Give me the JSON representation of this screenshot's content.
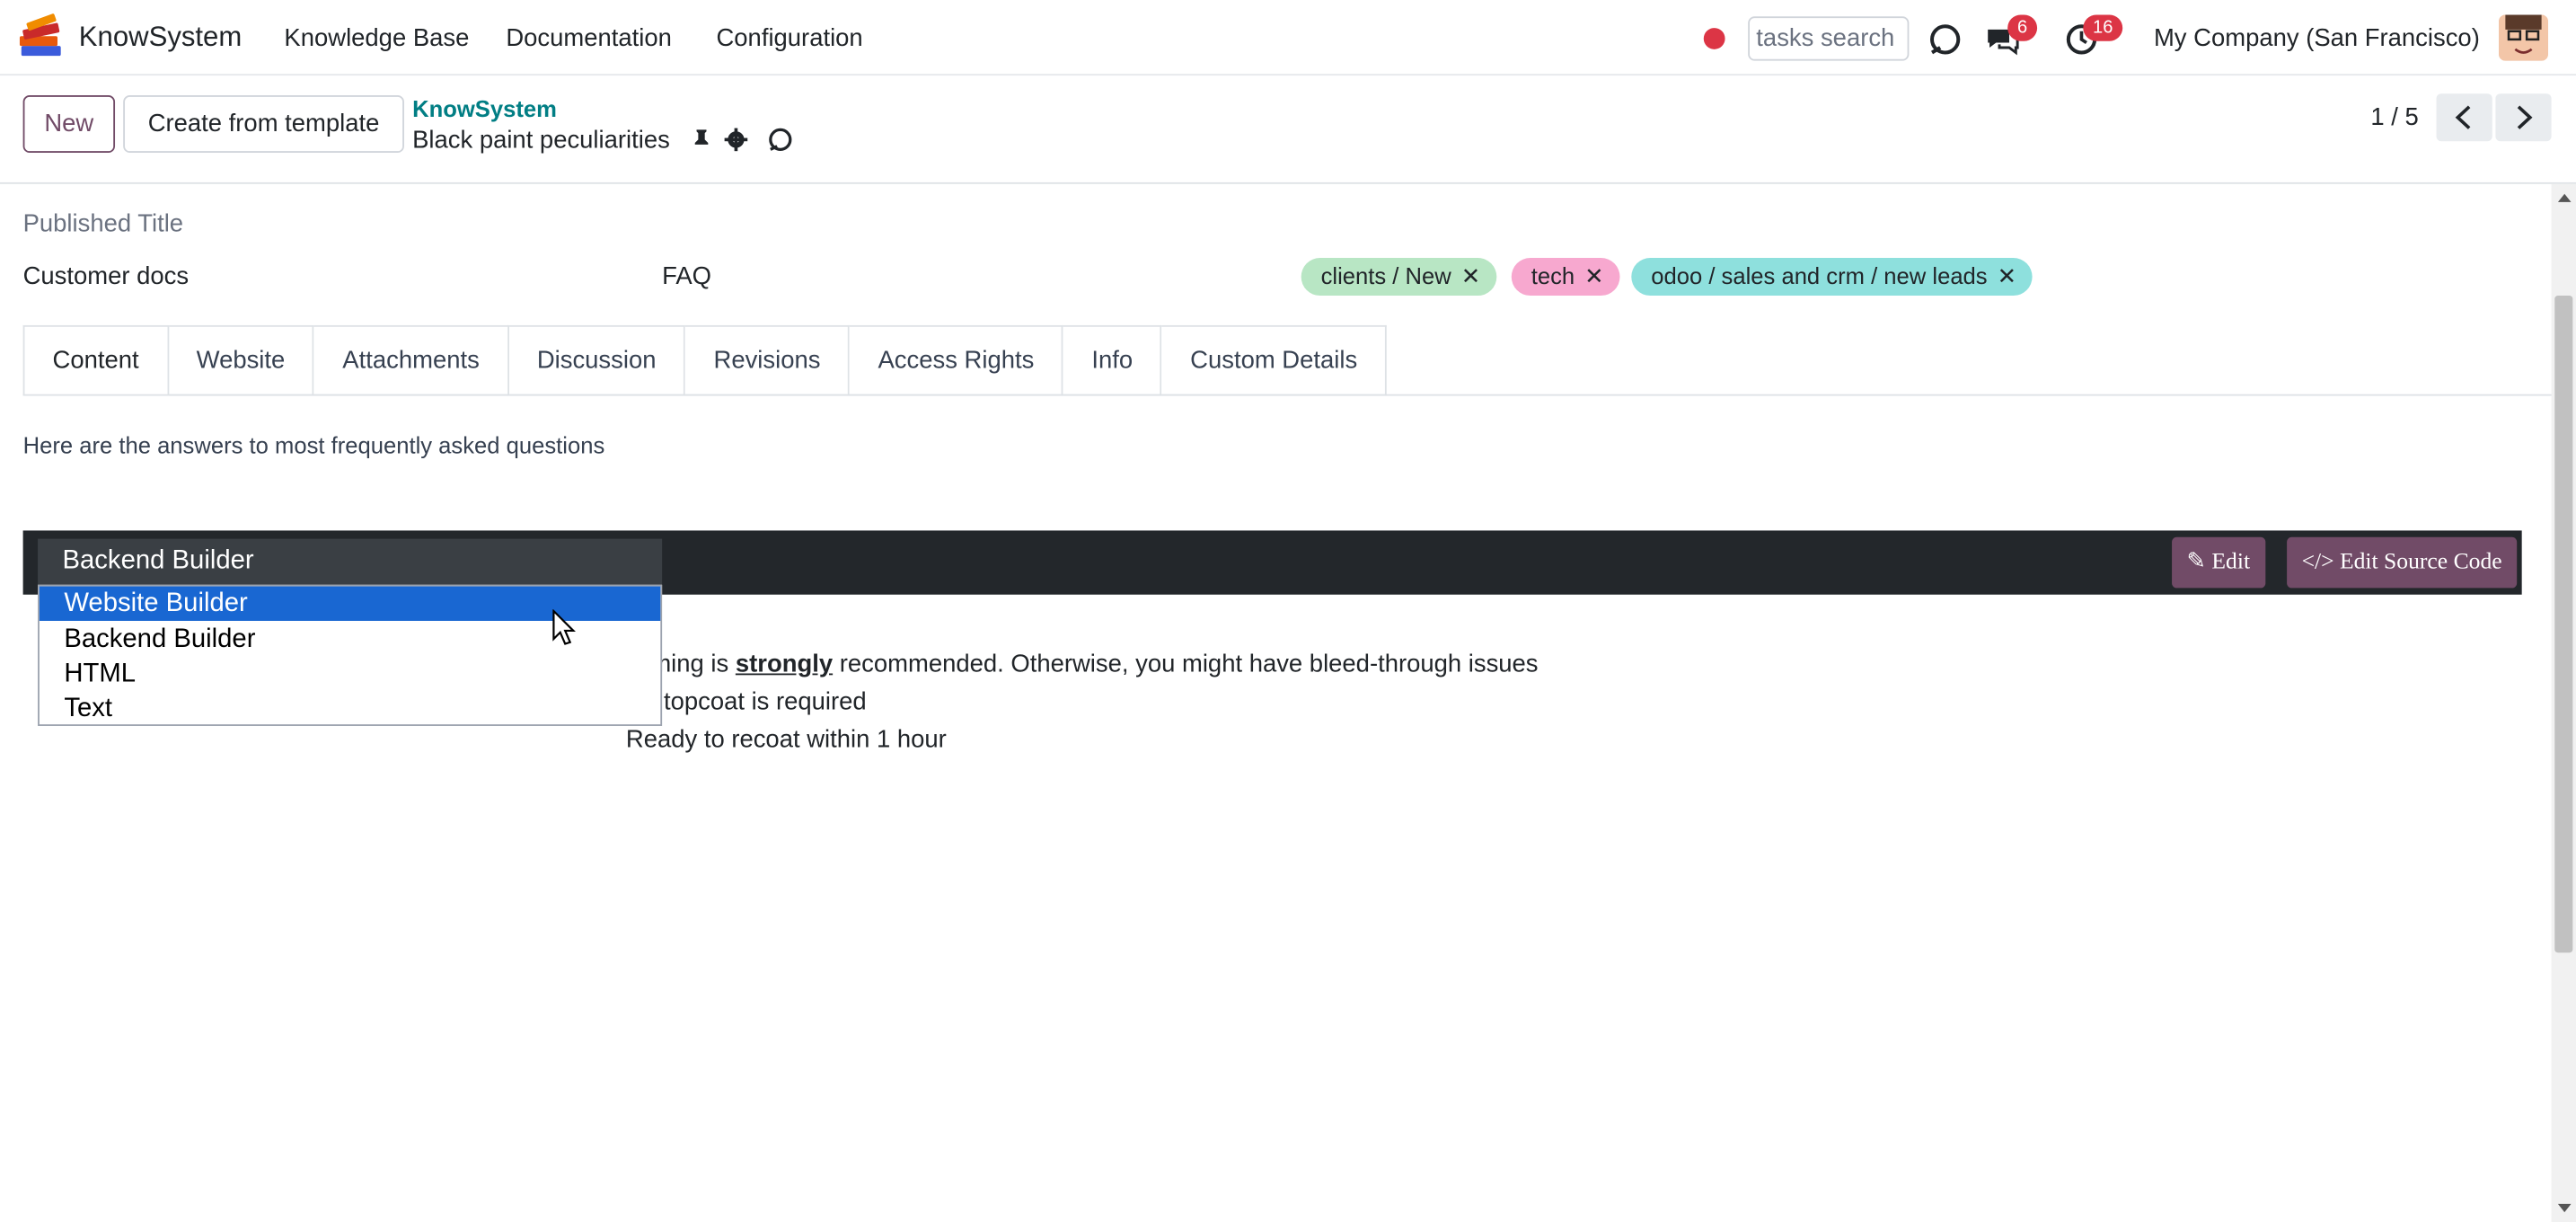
{
  "navbar": {
    "brand": "KnowSystem",
    "menus": [
      "Knowledge Base",
      "Documentation",
      "Configuration"
    ],
    "search_placeholder": "tasks search",
    "messages_badge": "6",
    "activities_badge": "16",
    "company": "My Company (San Francisco)"
  },
  "control_panel": {
    "new_label": "New",
    "template_label": "Create from template",
    "breadcrumb": "KnowSystem",
    "record_name": "Black paint peculiarities",
    "pager": "1 / 5"
  },
  "form": {
    "published_title_label": "Published Title",
    "section": "Customer docs",
    "type": "FAQ",
    "tags": [
      {
        "label": "clients / New",
        "color": "#b8e6c4"
      },
      {
        "label": "tech",
        "color": "#f7a8cf"
      },
      {
        "label": "odoo / sales and crm / new leads",
        "color": "#8ee0dd"
      }
    ]
  },
  "tabs": [
    "Content",
    "Website",
    "Attachments",
    "Discussion",
    "Revisions",
    "Access Rights",
    "Info",
    "Custom Details"
  ],
  "content": {
    "intro": "Here are the answers to most frequently asked questions",
    "editor_select_value": "Backend Builder",
    "edit_label": "Edit",
    "edit_source_label": "Edit Source Code",
    "dropdown_options": [
      "Website Builder",
      "Backend Builder",
      "HTML",
      "Text"
    ],
    "dropdown_highlighted": "Website Builder",
    "body_line1_start": "ming is ",
    "body_line1_strong": "strongly",
    "body_line1_end": " recommended. Otherwise, you might have bleed-through issues",
    "body_line2": "topcoat is required",
    "body_line3": "Ready to recoat within 1 hour"
  },
  "colors": {
    "primary": "#714B67",
    "link": "#017e84",
    "badge": "#dc3545",
    "editor_bar": "#23272b",
    "dropdown_highlight": "#1967d2"
  }
}
